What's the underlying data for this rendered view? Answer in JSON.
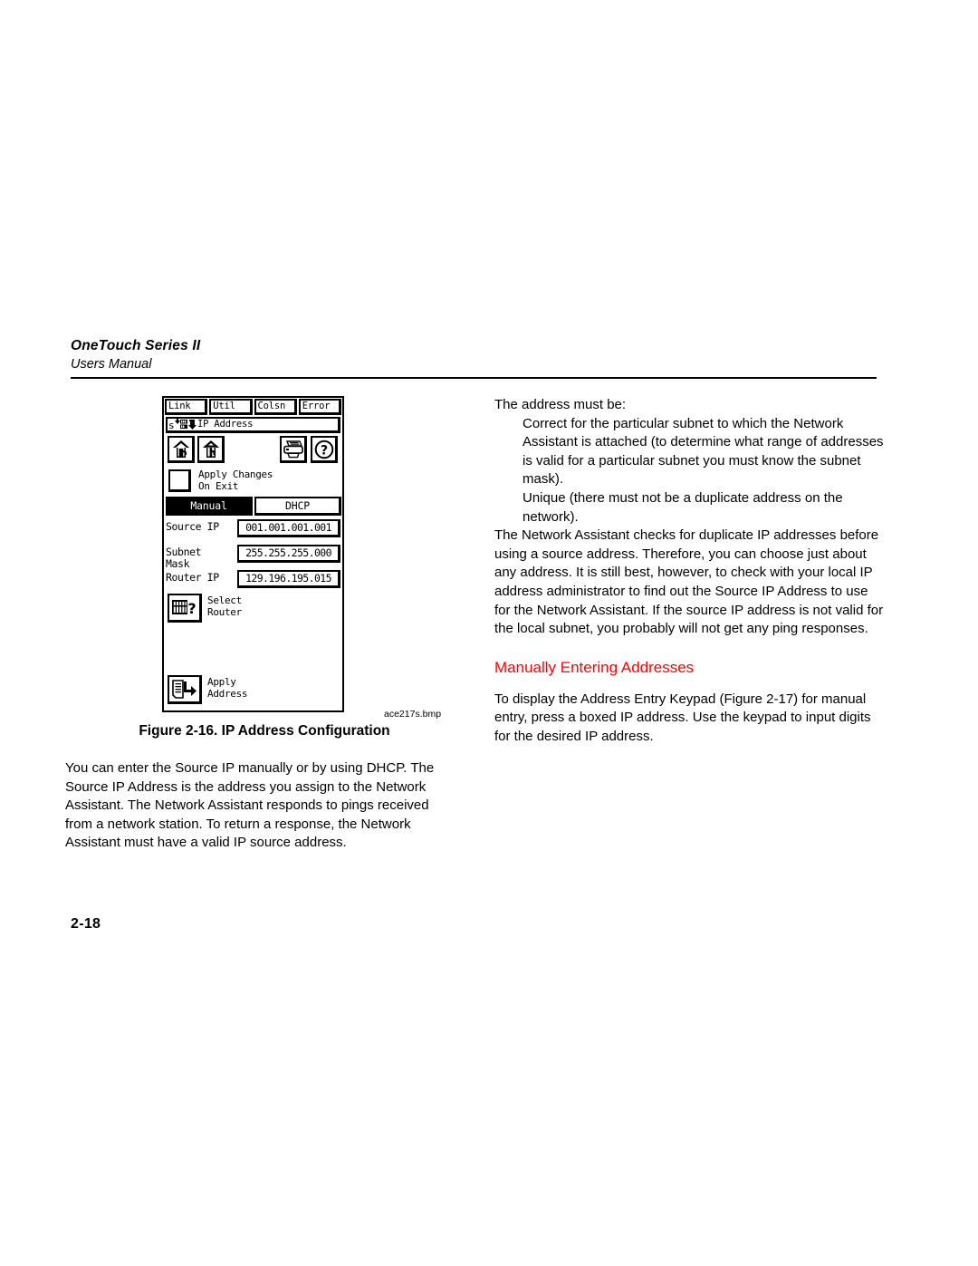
{
  "header": {
    "title": "OneTouch Series II",
    "subtitle": "Users Manual"
  },
  "page_number": "2-18",
  "figure": {
    "file_label": "ace217s.bmp",
    "caption": "Figure 2-16. IP Address Configuration"
  },
  "device": {
    "status_tabs": [
      "Link",
      "Util",
      "Colsn",
      "Error"
    ],
    "title_bar": {
      "text": "IP Address",
      "icons": [
        "speed-100mb-icon",
        "link-down-icon"
      ]
    },
    "toolbar": [
      {
        "name": "exit-up-arrow-icon",
        "label": ""
      },
      {
        "name": "up-one-level-arrow-icon",
        "label": ""
      },
      {
        "name": "printer-icon",
        "label": ""
      },
      {
        "name": "help-question-icon",
        "label": ""
      }
    ],
    "checkbox": {
      "label": "Apply Changes\nOn Exit",
      "checked": false
    },
    "mode_tabs": [
      {
        "label": "Manual",
        "selected": true
      },
      {
        "label": "DHCP",
        "selected": false
      }
    ],
    "fields": [
      {
        "label": "Source IP",
        "value": "001.001.001.001"
      },
      {
        "label": "Subnet\nMask",
        "value": "255.255.255.000"
      },
      {
        "label": "Router IP",
        "value": "129.196.195.015"
      }
    ],
    "actions": [
      {
        "icon": "router-select-icon",
        "label": "Select\nRouter"
      },
      {
        "icon": "apply-address-icon",
        "label": "Apply\nAddress"
      }
    ]
  },
  "right_column": {
    "intro": "The address must be:",
    "bullets": [
      "Correct for the particular subnet to which the Network Assistant is attached (to determine what range of addresses is valid for a particular subnet you must know the subnet mask).",
      "Unique (there must not be a duplicate address on the network)."
    ],
    "paragraph": "The Network Assistant checks for duplicate IP addresses before using a source address. Therefore, you can choose just about any address. It is still best, however, to check with your local IP address administrator to find out the Source IP Address to use for the Network Assistant. If the source IP address is not valid for the local subnet, you probably will not get any ping responses.",
    "heading": "Manually Entering Addresses",
    "heading_color": "#ff0000",
    "after_heading": "To display the Address Entry Keypad (Figure 2-17) for manual entry, press a boxed IP address. Use the keypad to input digits for the desired IP address."
  },
  "left_column": {
    "body": "You can enter the Source IP manually or by using DHCP. The Source IP Address is the address you assign to the Network Assistant. The Network Assistant responds to pings received from a network station. To return a response, the Network Assistant must have a valid IP source address."
  }
}
